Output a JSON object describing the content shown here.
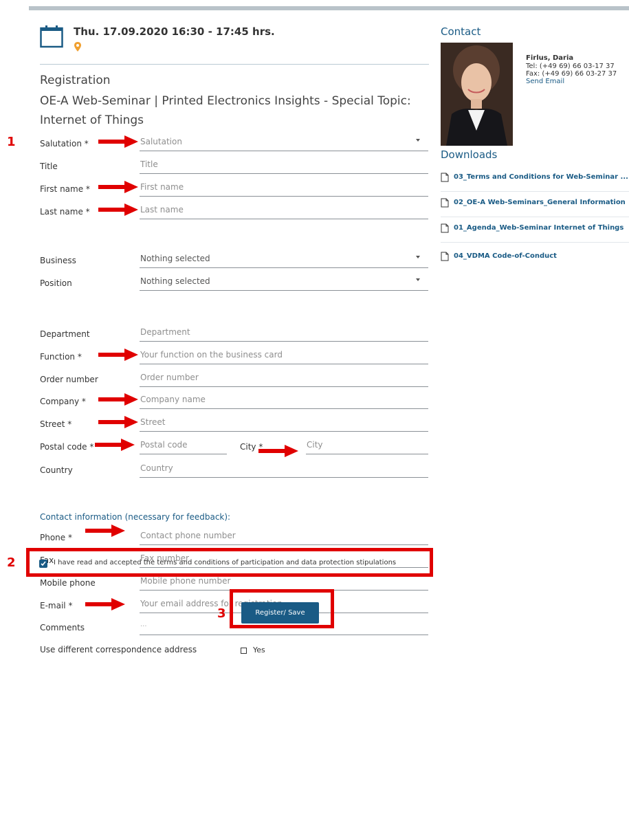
{
  "event": {
    "date_time": "Thu. 17.09.2020  16:30 - 17:45 hrs."
  },
  "registration": {
    "heading": "Registration",
    "seminar_title": "OE-A Web-Seminar | Printed Electronics Insights - Special Topic: Internet of Things"
  },
  "form": {
    "salutation": {
      "label": "Salutation *",
      "placeholder": "Salutation"
    },
    "title": {
      "label": "Title",
      "placeholder": "Title"
    },
    "first_name": {
      "label": "First name *",
      "placeholder": "First name"
    },
    "last_name": {
      "label": "Last name *",
      "placeholder": "Last name"
    },
    "business": {
      "label": "Business",
      "value": "Nothing selected"
    },
    "position": {
      "label": "Position",
      "value": "Nothing selected"
    },
    "department": {
      "label": "Department",
      "placeholder": "Department"
    },
    "function": {
      "label": "Function *",
      "placeholder": "Your function on the business card"
    },
    "order_number": {
      "label": "Order number",
      "placeholder": "Order number"
    },
    "company": {
      "label": "Company *",
      "placeholder": "Company name"
    },
    "street": {
      "label": "Street *",
      "placeholder": "Street"
    },
    "postal_code": {
      "label": "Postal code *",
      "placeholder": "Postal code"
    },
    "city": {
      "label": "City *",
      "placeholder": "City"
    },
    "country": {
      "label": "Country",
      "placeholder": "Country"
    },
    "contact_section_title": "Contact information (necessary for feedback):",
    "phone": {
      "label": "Phone *",
      "placeholder": "Contact phone number"
    },
    "fax": {
      "label": "Fax",
      "placeholder": "Fax number"
    },
    "mobile": {
      "label": "Mobile phone",
      "placeholder": "Mobile phone number"
    },
    "email": {
      "label": "E-mail *",
      "placeholder": "Your email address for registration"
    },
    "comments": {
      "label": "Comments",
      "placeholder": "..."
    },
    "different_address": {
      "label": "Use different correspondence address",
      "option": "Yes",
      "checked": false
    }
  },
  "terms": {
    "text": "I have read and accepted the terms and conditions of participation and data protection stipulations",
    "checked": true
  },
  "submit": {
    "label": "Register/ Save"
  },
  "annotations": {
    "n1": "1",
    "n2": "2",
    "n3": "3"
  },
  "contact": {
    "heading": "Contact",
    "name": "Firlus, Daria",
    "tel": "Tel: (+49 69) 66 03-17 37",
    "fax": "Fax: (+49 69) 66 03-27 37",
    "email_link": "Send Email"
  },
  "downloads": {
    "heading": "Downloads",
    "items": [
      "03_Terms and Conditions for Web-Seminar ...",
      "02_OE-A Web-Seminars_General Information",
      "01_Agenda_Web-Seminar Internet of Things",
      "04_VDMA Code-of-Conduct"
    ]
  },
  "colors": {
    "accent": "#1a5b85",
    "annotation_red": "#e00000",
    "location_pin": "#f0a030"
  }
}
